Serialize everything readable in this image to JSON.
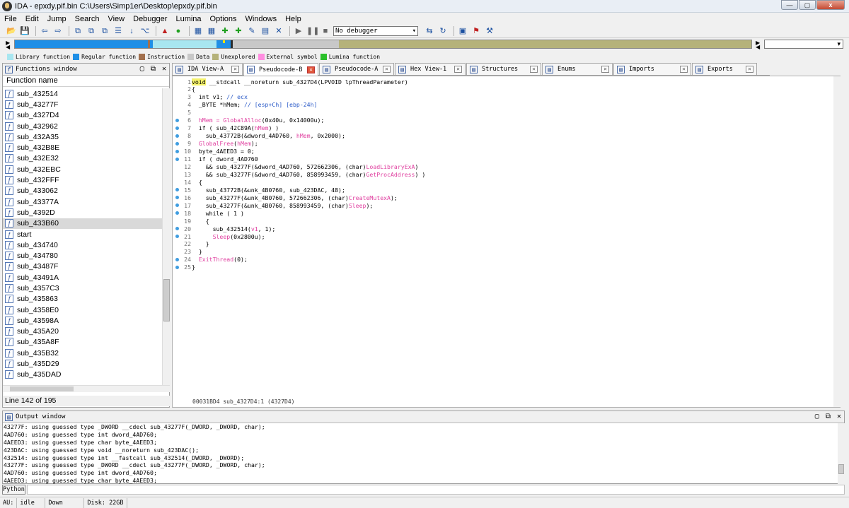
{
  "window": {
    "title": "IDA - epxdy.pif.bin C:\\Users\\Simp1er\\Desktop\\epxdy.pif.bin",
    "controls": [
      "—",
      "▢",
      "x"
    ]
  },
  "menu": [
    "File",
    "Edit",
    "Jump",
    "Search",
    "View",
    "Debugger",
    "Lumina",
    "Options",
    "Windows",
    "Help"
  ],
  "toolbar": {
    "debugger_select": "No debugger"
  },
  "legend": [
    {
      "label": "Library function",
      "color": "#a8e6f0"
    },
    {
      "label": "Regular function",
      "color": "#1f8fe6"
    },
    {
      "label": "Instruction",
      "color": "#a2704e"
    },
    {
      "label": "Data",
      "color": "#c8c8c8"
    },
    {
      "label": "Unexplored",
      "color": "#b5b27a"
    },
    {
      "label": "External symbol",
      "color": "#ff8de0"
    },
    {
      "label": "Lumina function",
      "color": "#2bc02b"
    }
  ],
  "functions_window": {
    "title": "Functions window",
    "column_header": "Function name",
    "items": [
      "sub_432514",
      "sub_43277F",
      "sub_4327D4",
      "sub_432962",
      "sub_432A35",
      "sub_432B8E",
      "sub_432E32",
      "sub_432EBC",
      "sub_432FFF",
      "sub_433062",
      "sub_43377A",
      "sub_4392D",
      "sub_433B60",
      "start",
      "sub_434740",
      "sub_434780",
      "sub_43487F",
      "sub_43491A",
      "sub_4357C3",
      "sub_435863",
      "sub_4358E0",
      "sub_43598A",
      "sub_435A20",
      "sub_435A8F",
      "sub_435B32",
      "sub_435D29",
      "sub_435DAD"
    ],
    "selected_index": 12,
    "status": "Line 142 of 195"
  },
  "tabs": [
    {
      "label": "IDA View-A",
      "icon": "ida-view-icon",
      "active": false
    },
    {
      "label": "Pseudocode-B",
      "icon": "pseudocode-icon",
      "active": true
    },
    {
      "label": "Pseudocode-A",
      "icon": "pseudocode-icon",
      "active": false
    },
    {
      "label": "Hex View-1",
      "icon": "hex-view-icon",
      "active": false
    },
    {
      "label": "Structures",
      "icon": "structures-icon",
      "active": false
    },
    {
      "label": "Enums",
      "icon": "enums-icon",
      "active": false
    },
    {
      "label": "Imports",
      "icon": "imports-icon",
      "active": false
    },
    {
      "label": "Exports",
      "icon": "exports-icon",
      "active": false
    }
  ],
  "code": {
    "lines": [
      {
        "n": "1",
        "dot": false,
        "html": "<span class='kw'>void</span> __stdcall __noreturn sub_4327D4(LPVOID lpThreadParameter)"
      },
      {
        "n": "2",
        "dot": false,
        "html": "{"
      },
      {
        "n": "3",
        "dot": false,
        "html": "  int v1; <span class='cm'>// ecx</span>"
      },
      {
        "n": "4",
        "dot": false,
        "html": "  _BYTE *hMem; <span class='cm'>// [esp+Ch] [ebp-24h]</span>"
      },
      {
        "n": "5",
        "dot": false,
        "html": ""
      },
      {
        "n": "6",
        "dot": true,
        "html": "  <span class='fnc'>hMem = GlobalAlloc</span>(0x40u, 0x14000u);"
      },
      {
        "n": "7",
        "dot": true,
        "html": "  if ( sub_42C89A(<span class='fnc'>hMem</span>) )"
      },
      {
        "n": "8",
        "dot": true,
        "html": "    sub_43772B(&amp;dword_4AD760, <span class='fnc'>hMem</span>, 0x2000);"
      },
      {
        "n": "9",
        "dot": true,
        "html": "  <span class='fnc'>GlobalFree</span>(<span class='fnc'>hMem</span>);"
      },
      {
        "n": "10",
        "dot": true,
        "html": "  byte_4AEED3 = 0;"
      },
      {
        "n": "11",
        "dot": true,
        "html": "  if ( dword_4AD760"
      },
      {
        "n": "12",
        "dot": false,
        "html": "    &amp;&amp; sub_43277F(&amp;dword_4AD760, 572662306, (char)<span class='fnc'>LoadLibraryExA</span>)"
      },
      {
        "n": "13",
        "dot": false,
        "html": "    &amp;&amp; sub_43277F(&amp;dword_4AD760, 858993459, (char)<span class='fnc'>GetProcAddress</span>) )"
      },
      {
        "n": "14",
        "dot": false,
        "html": "  {"
      },
      {
        "n": "15",
        "dot": true,
        "html": "    sub_43772B(&amp;unk_4B0760, sub_423DAC, 48);"
      },
      {
        "n": "16",
        "dot": true,
        "html": "    sub_43277F(&amp;unk_4B0760, 572662306, (char)<span class='fnc'>CreateMutexA</span>);"
      },
      {
        "n": "17",
        "dot": true,
        "html": "    sub_43277F(&amp;unk_4B0760, 858993459, (char)<span class='fnc'>Sleep</span>);"
      },
      {
        "n": "18",
        "dot": true,
        "html": "    while ( 1 )"
      },
      {
        "n": "19",
        "dot": false,
        "html": "    {"
      },
      {
        "n": "20",
        "dot": true,
        "html": "      sub_432514(<span class='fnc'>v1</span>, 1);"
      },
      {
        "n": "21",
        "dot": true,
        "html": "      <span class='fnc'>Sleep</span>(0x2800u);"
      },
      {
        "n": "22",
        "dot": false,
        "html": "    }"
      },
      {
        "n": "23",
        "dot": false,
        "html": "  }"
      },
      {
        "n": "24",
        "dot": true,
        "html": "  <span class='fnc'>ExitThread</span>(0);"
      },
      {
        "n": "25",
        "dot": true,
        "html": "}"
      }
    ],
    "status": "00031BD4 sub_4327D4:1 (4327D4)"
  },
  "output_window": {
    "title": "Output window",
    "lines": [
      "43277F: using guessed type _DWORD __cdecl sub_43277F(_DWORD, _DWORD, char);",
      "4AD760: using guessed type int dword_4AD760;",
      "4AEED3: using guessed type char byte_4AEED3;",
      "423DAC: using guessed type void __noreturn sub_423DAC();",
      "432514: using guessed type int __fastcall sub_432514(_DWORD, _DWORD);",
      "43277F: using guessed type _DWORD __cdecl sub_43277F(_DWORD, _DWORD, char);",
      "4AD760: using guessed type int dword_4AD760;",
      "4AEED3: using guessed type char byte_4AEED3;"
    ],
    "python_button": "Python"
  },
  "statusbar": {
    "au": "AU:",
    "state": "idle",
    "dir": "Down",
    "disk": "Disk: 22GB"
  }
}
